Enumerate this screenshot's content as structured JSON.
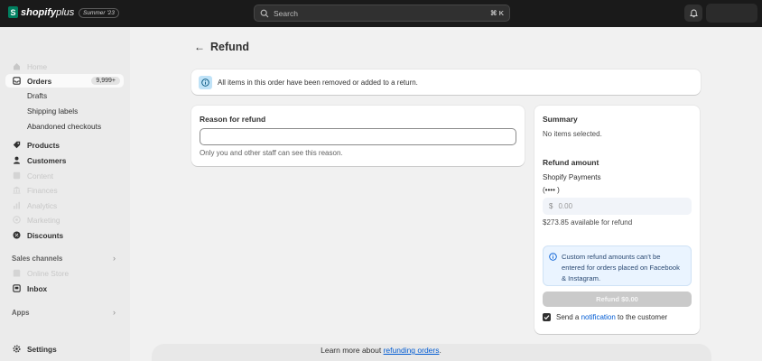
{
  "topbar": {
    "brand": "shopify",
    "brand_plus": "plus",
    "edition": "Summer '23",
    "search_placeholder": "Search",
    "search_shortcut": "⌘ K",
    "bell_icon": "bell-icon",
    "colors": {
      "background": "#1a1a1a",
      "brand_green": "#008060"
    }
  },
  "sidebar": {
    "home": "Home",
    "orders": "Orders",
    "orders_badge": "9,999+",
    "drafts": "Drafts",
    "shipping_labels": "Shipping labels",
    "abandoned_checkouts": "Abandoned checkouts",
    "products": "Products",
    "customers": "Customers",
    "content": "Content",
    "finances": "Finances",
    "analytics": "Analytics",
    "marketing": "Marketing",
    "discounts": "Discounts",
    "sales_channels": "Sales channels",
    "online_store": "Online Store",
    "inbox": "Inbox",
    "apps": "Apps",
    "settings": "Settings"
  },
  "page": {
    "title": "Refund",
    "banner": "All items in this order have been removed or added to a return."
  },
  "reason": {
    "heading": "Reason for refund",
    "value": "",
    "help": "Only you and other staff can see this reason."
  },
  "summary": {
    "heading": "Summary",
    "no_items": "No items selected.",
    "refund_amount_heading": "Refund amount",
    "provider": "Shopify Payments",
    "card_masked": "(••••       )",
    "currency": "$",
    "amount_placeholder": "0.00",
    "available": "$273.85 available for refund",
    "notice": "Custom refund amounts can't be entered for orders placed on Facebook & Instagram.",
    "refund_button": "Refund $0.00",
    "send_prefix": "Send a ",
    "send_link": "notification",
    "send_suffix": " to the customer",
    "send_checked": true
  },
  "footer": {
    "learn_prefix": "Learn more about ",
    "learn_link": "refunding orders",
    "learn_suffix": "."
  }
}
